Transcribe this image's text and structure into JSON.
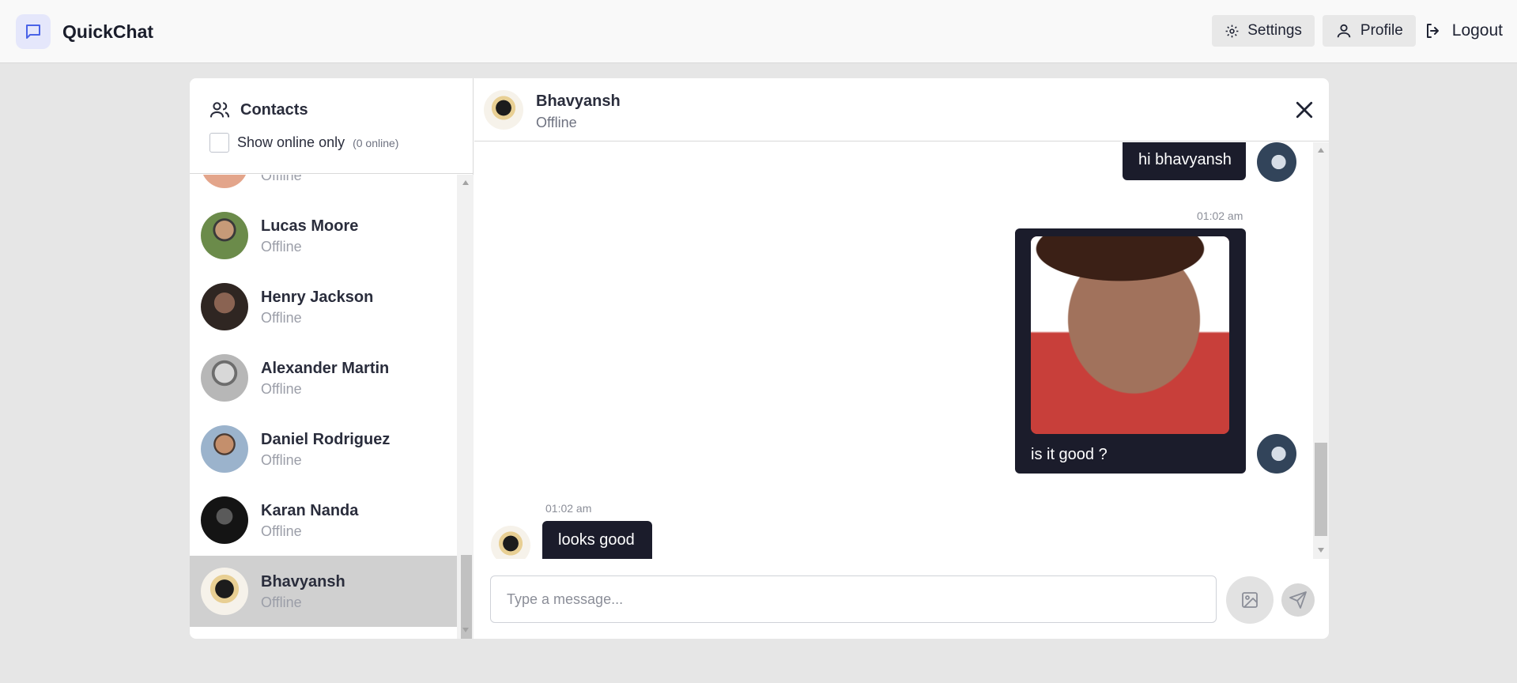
{
  "app": {
    "name": "QuickChat"
  },
  "header": {
    "settings_label": "Settings",
    "profile_label": "Profile",
    "logout_label": "Logout"
  },
  "sidebar": {
    "title": "Contacts",
    "filter_label": "Show online only",
    "online_count": "(0 online)",
    "contacts": [
      {
        "name": "",
        "status": "Offline",
        "avatar_color": "#e3a58b"
      },
      {
        "name": "Lucas Moore",
        "status": "Offline",
        "avatar_color": "#5b7a3e"
      },
      {
        "name": "Henry Jackson",
        "status": "Offline",
        "avatar_color": "#3d3330"
      },
      {
        "name": "Alexander Martin",
        "status": "Offline",
        "avatar_color": "#9e9e9e"
      },
      {
        "name": "Daniel Rodriguez",
        "status": "Offline",
        "avatar_color": "#8a9bb0"
      },
      {
        "name": "Karan Nanda",
        "status": "Offline",
        "avatar_color": "#1e1e1e"
      },
      {
        "name": "Bhavyansh",
        "status": "Offline",
        "avatar_color": "#c9a86a",
        "selected": true
      }
    ]
  },
  "chat": {
    "contact_name": "Bhavyansh",
    "contact_status": "Offline",
    "messages": [
      {
        "from": "me",
        "text": "hi bhavyansh",
        "time": ""
      },
      {
        "from": "me",
        "text": "is it good ?",
        "time": "01:02 am",
        "has_image": true
      },
      {
        "from": "them",
        "text": "looks good",
        "time": "01:02 am"
      }
    ],
    "input_placeholder": "Type a message..."
  },
  "icons": {
    "brand": "chat-bubble-icon",
    "settings": "gear-icon",
    "profile": "user-icon",
    "logout": "logout-icon",
    "contacts": "users-icon",
    "close": "close-icon",
    "image": "image-icon",
    "send": "send-icon"
  },
  "colors": {
    "accent": "#4a63e7",
    "bubble": "#1b1c2b",
    "selected_row": "#d0d0d0"
  }
}
